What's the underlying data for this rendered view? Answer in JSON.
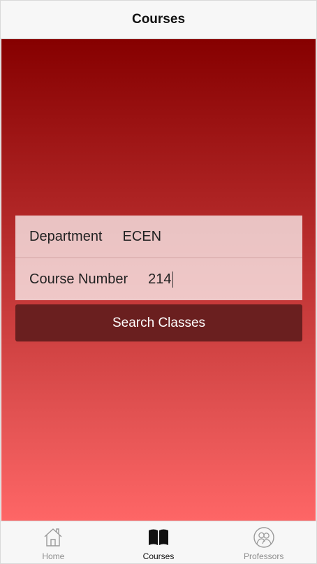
{
  "header": {
    "title": "Courses"
  },
  "form": {
    "department_label": "Department",
    "department_value": "ECEN",
    "course_number_label": "Course Number",
    "course_number_value": "214"
  },
  "search_button_label": "Search Classes",
  "tabs": [
    {
      "label": "Home",
      "icon": "home-icon",
      "active": false
    },
    {
      "label": "Courses",
      "icon": "book-icon",
      "active": true
    },
    {
      "label": "Professors",
      "icon": "professors-icon",
      "active": false
    }
  ],
  "colors": {
    "gradient_top": "#860000",
    "gradient_bottom": "#fe6666",
    "button_bg": "#6a1f1f",
    "tab_active": "#111111",
    "tab_inactive": "#8e8e8e"
  }
}
